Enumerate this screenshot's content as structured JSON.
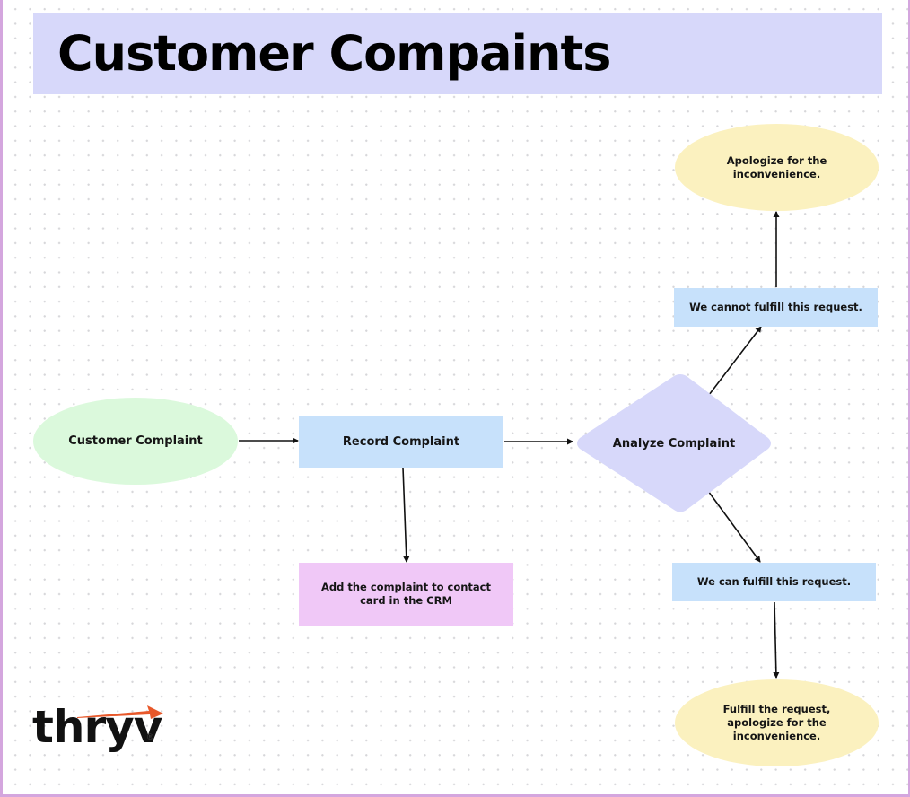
{
  "title": "Customer Compaints",
  "colors": {
    "banner": "#d7d8fa",
    "green_oval": "#dbf9dc",
    "blue_box": "#c7e1fb",
    "diamond": "#d7d8fa",
    "pink_box": "#f0c8f7",
    "yellow_oval": "#fbf1bf",
    "frame_border": "#d4a6de",
    "logo_arrow": "#e8582a"
  },
  "nodes": {
    "customer_complaint": "Customer Complaint",
    "record_complaint": "Record Complaint",
    "analyze_complaint": "Analyze Complaint",
    "add_to_crm": "Add the complaint to contact card in the CRM",
    "cannot_fulfill": "We cannot fulfill this request.",
    "apologize": "Apologize for the inconvenience.",
    "can_fulfill": "We can fulfill this request.",
    "fulfill_apologize": "Fulfill the request, apologize for the inconvenience."
  },
  "logo": {
    "text": "thryv",
    "registered": "®"
  }
}
